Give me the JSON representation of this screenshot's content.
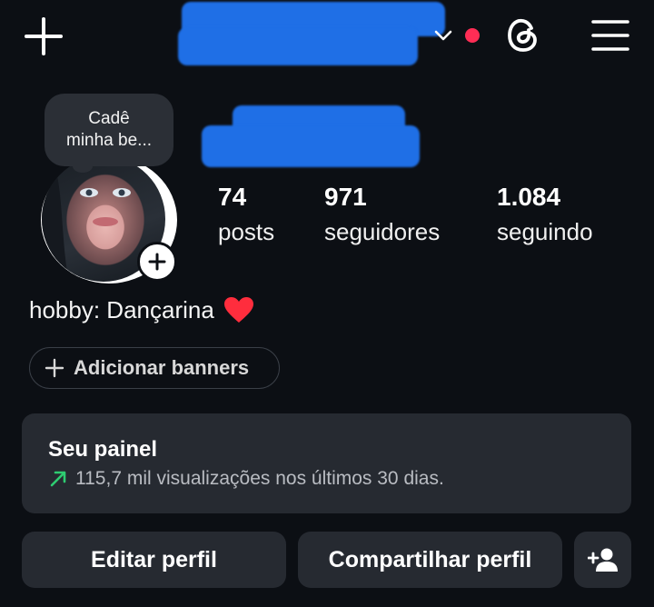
{
  "header": {
    "create_icon": "plus-icon",
    "account_switch_icon": "chevron-down-icon",
    "notification_dot_color": "#ff2d55",
    "threads_icon": "threads-icon",
    "menu_icon": "hamburger-menu-icon"
  },
  "profile": {
    "note": [
      "Cadê",
      "minha be..."
    ],
    "stats": [
      {
        "value": "74",
        "label": "posts"
      },
      {
        "value": "971",
        "label": "seguidores"
      },
      {
        "value": "1.084",
        "label": "seguindo"
      }
    ],
    "bio": "hobby: Dançarina",
    "bio_emoji": "❤️",
    "add_banners": "Adicionar banners"
  },
  "dashboard": {
    "title": "Seu painel",
    "subtitle": "115,7 mil visualizações nos últimos 30 dias.",
    "trend_color": "#2ecc71"
  },
  "actions": {
    "edit_profile": "Editar perfil",
    "share_profile": "Compartilhar perfil",
    "discover_people_icon": "add-person-icon"
  }
}
